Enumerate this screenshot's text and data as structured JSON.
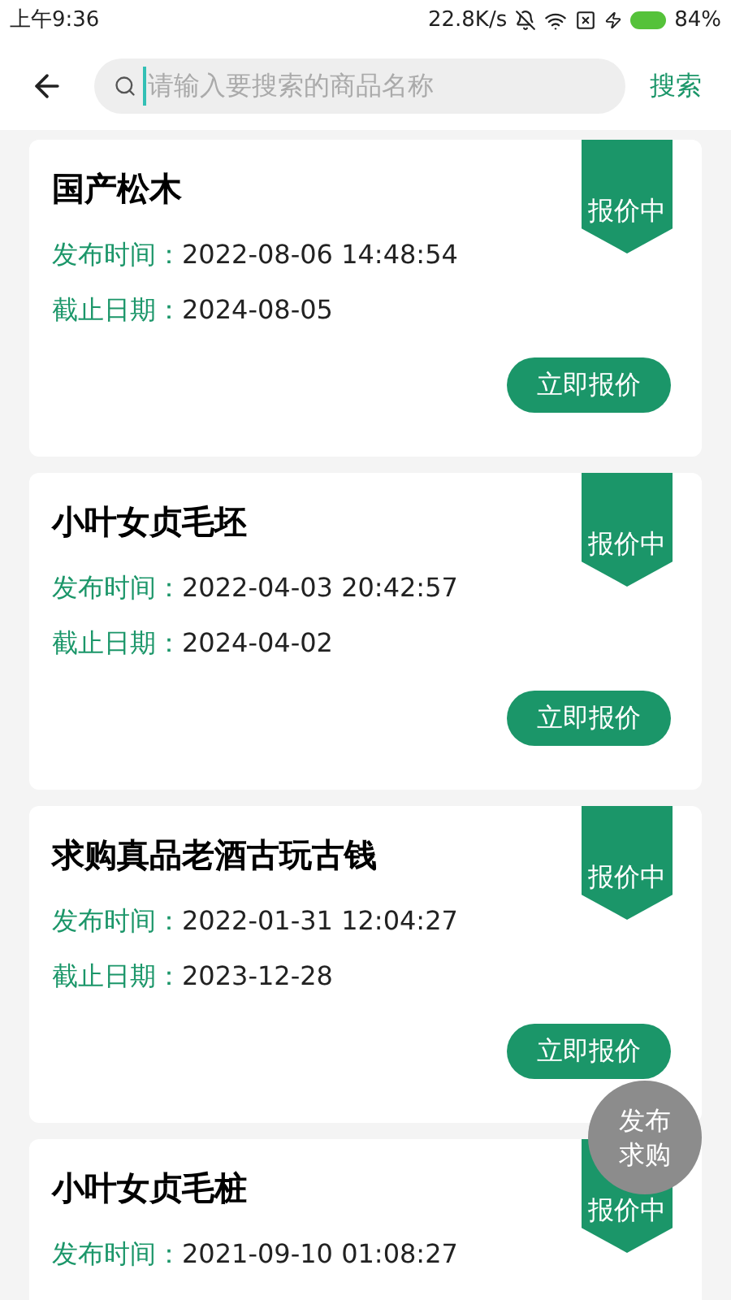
{
  "status_bar": {
    "time": "上午9:36",
    "speed": "22.8K/s",
    "battery": "84%"
  },
  "header": {
    "search_placeholder": "请输入要搜索的商品名称",
    "search_button": "搜索"
  },
  "listings": [
    {
      "title": "国产松木",
      "status": "报价中",
      "published_label": "发布时间：",
      "published": "2022-08-06 14:48:54",
      "deadline_label": "截止日期：",
      "deadline": "2024-08-05",
      "action": "立即报价"
    },
    {
      "title": "小叶女贞毛坯",
      "status": "报价中",
      "published_label": "发布时间：",
      "published": "2022-04-03 20:42:57",
      "deadline_label": "截止日期：",
      "deadline": "2024-04-02",
      "action": "立即报价"
    },
    {
      "title": "求购真品老酒古玩古钱",
      "status": "报价中",
      "published_label": "发布时间：",
      "published": "2022-01-31 12:04:27",
      "deadline_label": "截止日期：",
      "deadline": "2023-12-28",
      "action": "立即报价"
    },
    {
      "title": "小叶女贞毛桩",
      "status": "报价中",
      "published_label": "发布时间：",
      "published": "2021-09-10 01:08:27"
    }
  ],
  "fab": {
    "line_1": "发布",
    "line_2": "求购"
  }
}
